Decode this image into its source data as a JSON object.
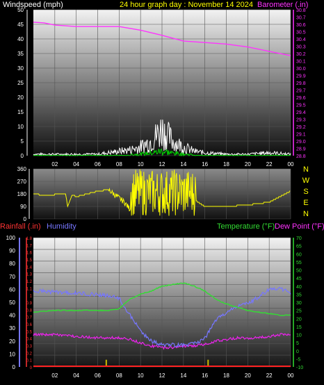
{
  "header": {
    "left": "Windspeed (mph)",
    "center": "24 hour graph day : November 14 2024",
    "right": "Barometer (.in)"
  },
  "colors": {
    "background": "#000000",
    "wind": "#ffffff",
    "gust": "#00dd00",
    "barometer": "#ff33ff",
    "direction": "#ffff00",
    "humidity": "#7777ff",
    "rainfall_label": "#ff3333",
    "rain_rate_scale": "#ff3333",
    "rain_bar": "#ccbb00",
    "temperature": "#33dd33",
    "dewpoint": "#ee22ee",
    "dewpoint_label": "#ff33ff",
    "header_center": "#ffff00"
  },
  "chart_data": [
    {
      "type": "line",
      "x_ticks": [
        "02",
        "04",
        "06",
        "08",
        "10",
        "12",
        "14",
        "16",
        "18",
        "20",
        "22",
        "00"
      ],
      "y_left": {
        "ticks": [
          "0",
          "5",
          "10",
          "15",
          "20",
          "25",
          "30",
          "35",
          "40",
          "45",
          "50"
        ],
        "ylim": [
          0,
          50
        ]
      },
      "y_right": {
        "ticks": [
          "28.8",
          "28.9",
          "29.0",
          "29.1",
          "29.2",
          "29.3",
          "29.4",
          "29.5",
          "29.6",
          "29.7",
          "29.8",
          "29.9",
          "30.0",
          "30.1",
          "30.2",
          "30.3",
          "30.4",
          "30.5",
          "30.6",
          "30.7",
          "30.8"
        ],
        "ylim": [
          28.8,
          30.8
        ]
      },
      "series": [
        {
          "name": "Windspeed (mph)",
          "axis": "left",
          "style": "noisy 1-5 mph, peak ~9 mph around 12:00",
          "x": [
            0,
            6,
            7,
            8,
            9,
            10,
            11,
            11.5,
            12,
            12.5,
            13,
            14,
            15,
            16,
            18,
            20,
            22,
            24
          ],
          "values": [
            0.5,
            0.5,
            1,
            1.5,
            2,
            3,
            5,
            7,
            9,
            7,
            5,
            3,
            1.5,
            1,
            0.5,
            0.5,
            1,
            0.5
          ]
        },
        {
          "name": "Barometer (.in)",
          "axis": "right",
          "x": [
            0,
            1,
            2,
            4,
            6,
            8,
            10,
            12,
            14,
            16,
            18,
            20,
            22,
            24
          ],
          "values": [
            30.63,
            30.62,
            30.59,
            30.57,
            30.57,
            30.57,
            30.52,
            30.45,
            30.37,
            30.35,
            30.33,
            30.29,
            30.23,
            30.17
          ]
        }
      ]
    },
    {
      "type": "line",
      "y_ticks": [
        "0",
        "90",
        "180",
        "270",
        "360"
      ],
      "ylim": [
        0,
        360
      ],
      "direction_labels": [
        "N",
        "W",
        "S",
        "E",
        "N"
      ],
      "series": [
        {
          "name": "Wind direction",
          "x": [
            0,
            1,
            2,
            3,
            3.2,
            3.6,
            4,
            5,
            6,
            7,
            7.5,
            8,
            8.5,
            9,
            10,
            11,
            12,
            13,
            14,
            15,
            16,
            18,
            20,
            22,
            23,
            24
          ],
          "values": [
            180,
            170,
            175,
            185,
            90,
            175,
            160,
            180,
            200,
            210,
            180,
            150,
            120,
            70,
            220,
            160,
            90,
            70,
            160,
            140,
            90,
            90,
            100,
            120,
            160,
            200
          ]
        }
      ]
    },
    {
      "type": "line",
      "y_left_rain": {
        "ticks": [
          "0",
          "0.1",
          "0.2",
          "0.3",
          "0.4",
          "0.5",
          "0.6",
          "0.7",
          "0.8",
          "0.9",
          "1",
          "1.1"
        ],
        "ylim": [
          0,
          1.1
        ]
      },
      "y_left_rate": {
        "ticks": [
          "0",
          "0.1",
          "0.2",
          "0.3",
          "0.4",
          "0.5",
          "0.6",
          "0.7",
          "0.8",
          "0.9",
          "1",
          "1.1",
          "1.2",
          "1.3",
          "1.4",
          "1.5",
          "1.6",
          "1.7",
          "1.8"
        ],
        "ylim": [
          0,
          1.8
        ]
      },
      "y_left_humidity": {
        "ticks": [
          "0",
          "10",
          "20",
          "30",
          "40",
          "50",
          "60",
          "70",
          "80",
          "90",
          "100"
        ],
        "ylim": [
          0,
          100
        ]
      },
      "y_right": {
        "ticks": [
          "-10",
          "-5",
          "0",
          "5",
          "10",
          "15",
          "20",
          "25",
          "30",
          "35",
          "40",
          "45",
          "50",
          "55",
          "60",
          "65",
          "70"
        ],
        "ylim": [
          -10,
          70
        ]
      },
      "labels": {
        "rainfall": "Rainfall (.in)",
        "humidity": "Humidity",
        "temperature": "Temperature (°F)",
        "dewpoint": "Dew Point (°F)"
      },
      "series": [
        {
          "name": "Humidity",
          "axis": "humidity",
          "x": [
            0,
            2,
            4,
            6,
            7,
            8,
            9,
            10,
            11,
            12,
            13,
            14,
            15,
            16,
            17,
            18,
            19,
            20,
            21,
            22,
            23,
            24
          ],
          "values": [
            59,
            58,
            57,
            56,
            55,
            53,
            40,
            28,
            20,
            17,
            17,
            17,
            18,
            22,
            36,
            42,
            47,
            49,
            54,
            60,
            61,
            57
          ]
        },
        {
          "name": "Temperature (°F)",
          "axis": "right",
          "x": [
            0,
            2,
            4,
            6,
            7,
            8,
            9,
            10,
            11,
            12,
            13,
            14,
            15,
            16,
            17,
            18,
            19,
            20,
            21,
            22,
            23,
            24
          ],
          "values": [
            24,
            25,
            25,
            25,
            25,
            26,
            32,
            35,
            37,
            40,
            41,
            42,
            40,
            37,
            32,
            29,
            27,
            25,
            24,
            23,
            22,
            22
          ]
        },
        {
          "name": "Dew Point (°F)",
          "axis": "right",
          "x": [
            0,
            2,
            4,
            6,
            7,
            8,
            9,
            10,
            11,
            12,
            13,
            14,
            15,
            16,
            17,
            18,
            19,
            20,
            21,
            22,
            23,
            24
          ],
          "values": [
            10,
            10,
            9,
            8,
            8,
            8,
            7,
            5,
            3,
            2,
            2,
            3,
            3,
            4,
            6,
            7,
            8,
            8,
            8,
            9,
            10,
            10
          ]
        },
        {
          "name": "Rainfall (.in)",
          "axis": "rain",
          "x": [
            0,
            24
          ],
          "values": [
            0,
            0
          ]
        },
        {
          "name": "Rain rate",
          "axis": "rate",
          "type": "bar",
          "x": [
            6.8,
            16.3
          ],
          "values": [
            0.1,
            0.1
          ]
        }
      ]
    }
  ]
}
